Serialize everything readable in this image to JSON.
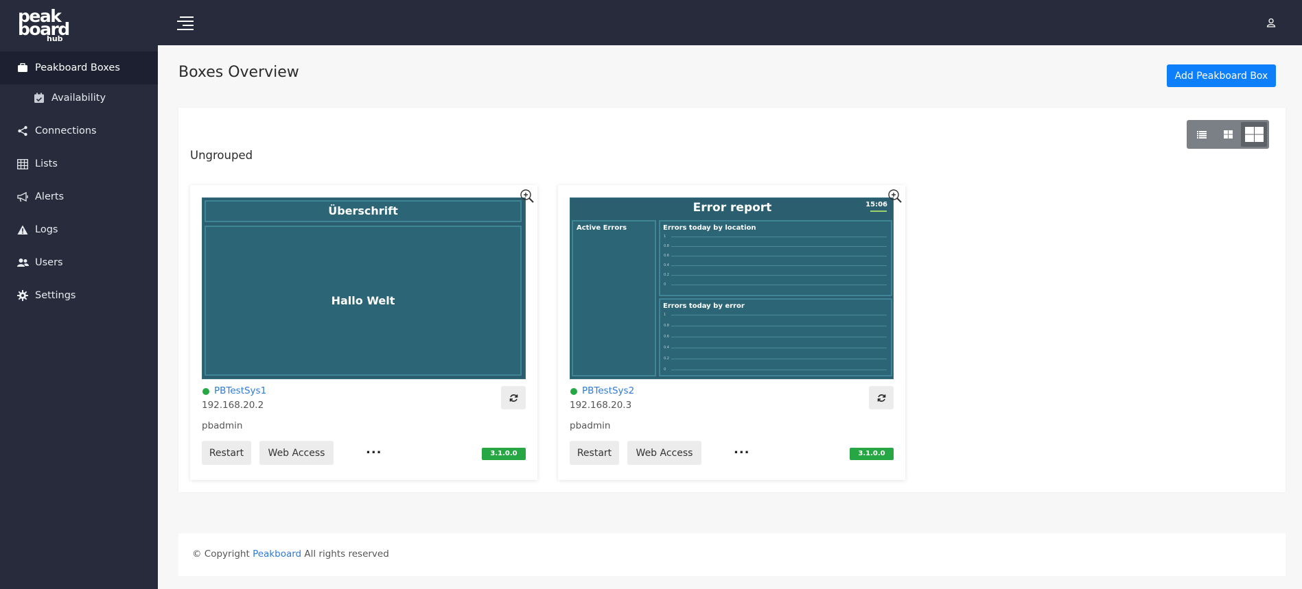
{
  "brand": {
    "line1": "peak",
    "line2": "board",
    "line3": "hub"
  },
  "sidebar": {
    "items": [
      {
        "label": "Peakboard Boxes",
        "icon": "box-icon"
      },
      {
        "label": "Availability",
        "icon": "calendar-check-icon"
      },
      {
        "label": "Connections",
        "icon": "share-icon"
      },
      {
        "label": "Lists",
        "icon": "table-icon"
      },
      {
        "label": "Alerts",
        "icon": "megaphone-icon"
      },
      {
        "label": "Logs",
        "icon": "warning-icon"
      },
      {
        "label": "Users",
        "icon": "users-icon"
      },
      {
        "label": "Settings",
        "icon": "gear-icon"
      }
    ]
  },
  "header": {
    "menu_icon": "menu-icon",
    "user_icon": "user-icon"
  },
  "main": {
    "title": "Boxes Overview",
    "add_button": "Add Peakboard Box",
    "group_title": "Ungrouped"
  },
  "cards": [
    {
      "name": "PBTestSys1",
      "ip": "192.168.20.2",
      "user": "pbadmin",
      "restart": "Restart",
      "web_access": "Web Access",
      "more": "...",
      "version": "3.1.0.0",
      "status_color": "#26a845",
      "preview": {
        "heading": "Überschrift",
        "body": "Hallo Welt"
      }
    },
    {
      "name": "PBTestSys2",
      "ip": "192.168.20.3",
      "user": "pbadmin",
      "restart": "Restart",
      "web_access": "Web Access",
      "more": "...",
      "version": "3.1.0.0",
      "status_color": "#26a845",
      "preview": {
        "heading": "Error report",
        "clock": "15:06",
        "panel_active": "Active Errors",
        "panel_location": "Errors today by location",
        "panel_error": "Errors today by error",
        "ticks": [
          "1",
          "0.8",
          "0.6",
          "0.4",
          "0.2",
          "0"
        ]
      }
    }
  ],
  "footer": {
    "prefix": "© Copyright",
    "link": "Peakboard",
    "suffix": "All rights reserved"
  },
  "colors": {
    "sidebar": "#272b3b",
    "accent": "#0d7ffb",
    "status_green": "#26a845",
    "preview_bg": "#2b5f6f"
  }
}
